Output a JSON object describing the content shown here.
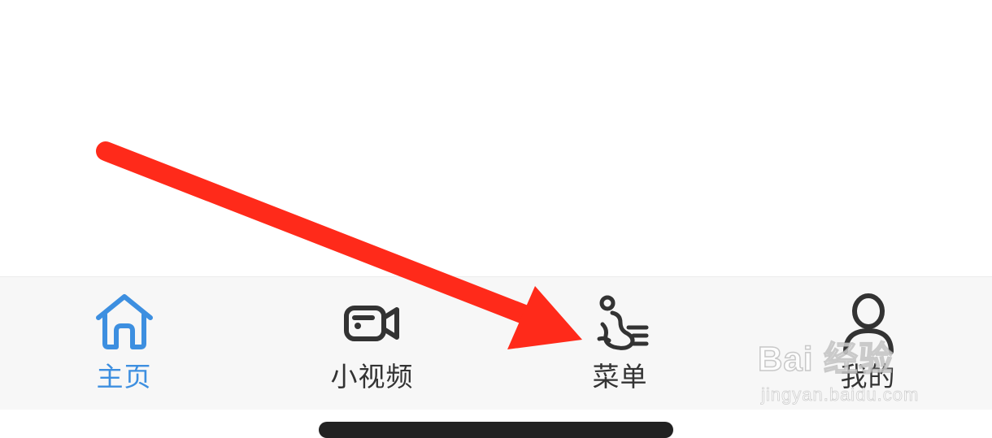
{
  "tab_bar": {
    "active_color": "#3d8fe0",
    "inactive_color": "#333333",
    "tabs": [
      {
        "label": "主页",
        "icon": "home-icon",
        "active": true
      },
      {
        "label": "小视频",
        "icon": "video-camera-icon",
        "active": false
      },
      {
        "label": "菜单",
        "icon": "menu-footprint-icon",
        "active": false
      },
      {
        "label": "我的",
        "icon": "user-profile-icon",
        "active": false
      }
    ]
  },
  "annotation": {
    "type": "arrow",
    "color": "#ff2a1a",
    "points_to": "菜单"
  },
  "watermark": {
    "brand": "Bai 经验",
    "url": "jingyan.baidu.com"
  }
}
